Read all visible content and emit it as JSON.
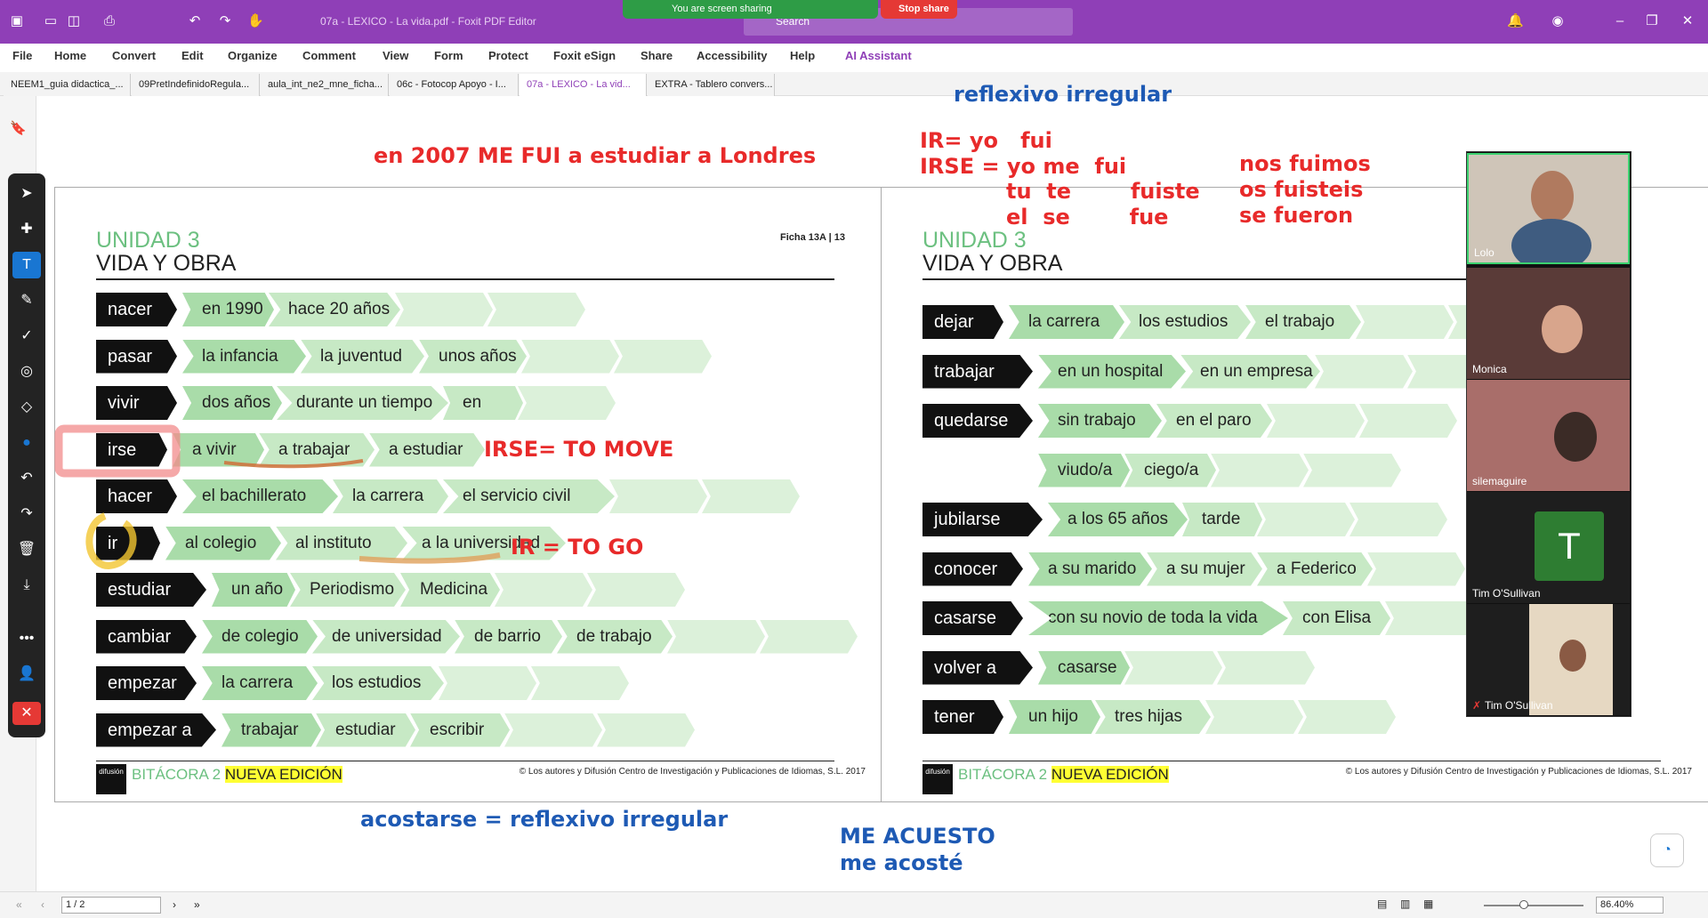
{
  "app": {
    "document_title": "07a - LEXICO - La vida.pdf - Foxit PDF Editor",
    "search_placeholder": "Search"
  },
  "screen_share": {
    "status": "You are screen sharing",
    "stop_label": "Stop share"
  },
  "menu": [
    "File",
    "Home",
    "Convert",
    "Edit",
    "Organize",
    "Comment",
    "View",
    "Form",
    "Protect",
    "Foxit eSign",
    "Share",
    "Accessibility",
    "Help",
    "AI Assistant"
  ],
  "tabs": [
    "NEEM1_guia didactica_...",
    "09PretIndefinidoRegula...",
    "aula_int_ne2_mne_ficha...",
    "06c - Fotocop Apoyo - I...",
    "07a - LEXICO - La vid...",
    "EXTRA - Tablero convers..."
  ],
  "left_page": {
    "unit": "UNIDAD 3",
    "subtitle": "VIDA Y OBRA",
    "ficha": "Ficha 13A | 13",
    "rows": [
      {
        "verb": "nacer",
        "items": [
          "en 1990",
          "hace 20 años",
          "",
          ""
        ]
      },
      {
        "verb": "pasar",
        "items": [
          "la infancia",
          "la juventud",
          "unos años",
          "",
          ""
        ]
      },
      {
        "verb": "vivir",
        "items": [
          "dos años",
          "durante un tiempo",
          "en",
          ""
        ]
      },
      {
        "verb": "irse",
        "items": [
          "a vivir",
          "a trabajar",
          "a estudiar"
        ]
      },
      {
        "verb": "hacer",
        "items": [
          "el bachillerato",
          "la carrera",
          "el servicio civil",
          "",
          ""
        ]
      },
      {
        "verb": "ir",
        "items": [
          "al colegio",
          "al instituto",
          "a la universidad"
        ]
      },
      {
        "verb": "estudiar",
        "items": [
          "un año",
          "Periodismo",
          "Medicina",
          "",
          ""
        ]
      },
      {
        "verb": "cambiar",
        "items": [
          "de colegio",
          "de universidad",
          "de barrio",
          "de trabajo",
          "",
          ""
        ]
      },
      {
        "verb": "empezar",
        "items": [
          "la carrera",
          "los estudios",
          "",
          ""
        ]
      },
      {
        "verb": "empezar a",
        "items": [
          "trabajar",
          "estudiar",
          "escribir",
          "",
          ""
        ]
      }
    ],
    "brand": "BITÁCORA 2",
    "edition": "NUEVA EDICIÓN",
    "publisher": "difusión",
    "copyright": "© Los autores y Difusión Centro de Investigación y Publicaciones de Idiomas, S.L. 2017"
  },
  "right_page": {
    "unit": "UNIDAD 3",
    "subtitle": "VIDA Y OBRA",
    "rows": [
      {
        "verb": "dejar",
        "items": [
          "la carrera",
          "los estudios",
          "el trabajo",
          "",
          ""
        ]
      },
      {
        "verb": "trabajar",
        "items": [
          "en un hospital",
          "en un empresa",
          "",
          ""
        ]
      },
      {
        "verb": "quedarse",
        "items": [
          "sin trabajo",
          "en el paro",
          "",
          ""
        ]
      },
      {
        "verb": "",
        "items": [
          "viudo/a",
          "ciego/a",
          "",
          ""
        ]
      },
      {
        "verb": "jubilarse",
        "items": [
          "a los 65 años",
          "tarde",
          "",
          ""
        ]
      },
      {
        "verb": "conocer",
        "items": [
          "a su marido",
          "a su mujer",
          "a Federico",
          ""
        ]
      },
      {
        "verb": "casarse",
        "items": [
          "con su novio de toda la vida",
          "con Elisa",
          ""
        ]
      },
      {
        "verb": "volver a",
        "items": [
          "casarse",
          "",
          ""
        ]
      },
      {
        "verb": "tener",
        "items": [
          "un hijo",
          "tres hijas",
          "",
          ""
        ]
      }
    ],
    "brand": "BITÁCORA 2",
    "edition": "NUEVA EDICIÓN",
    "publisher": "difusión",
    "copyright": "© Los autores y Difusión Centro de Investigación y Publicaciones de Idiomas, S.L. 2017"
  },
  "annotations": {
    "reflexivo": "reflexivo irregular",
    "london": "en 2007 ME FUI a estudiar a Londres",
    "ir_yo": "IR= yo   fui",
    "irse_yo": "IRSE = yo me  fui",
    "tu": "tu  te        fuiste",
    "el": "el  se        fue",
    "nos": "nos fuimos\nos fuisteis\nse fueron",
    "irse_move": "IRSE= TO MOVE",
    "ir_go": "IR = TO GO",
    "acostarse": "acostarse = reflexivo irregular",
    "me_acuesto": "ME ACUESTO\nme acosté"
  },
  "participants": [
    "Lolo",
    "Monica",
    "silemaguire",
    "Tim O'Sullivan",
    "Tim O'Sullivan"
  ],
  "participant_initial": "T",
  "status": {
    "page": "1 / 2",
    "zoom": "86.40%"
  }
}
